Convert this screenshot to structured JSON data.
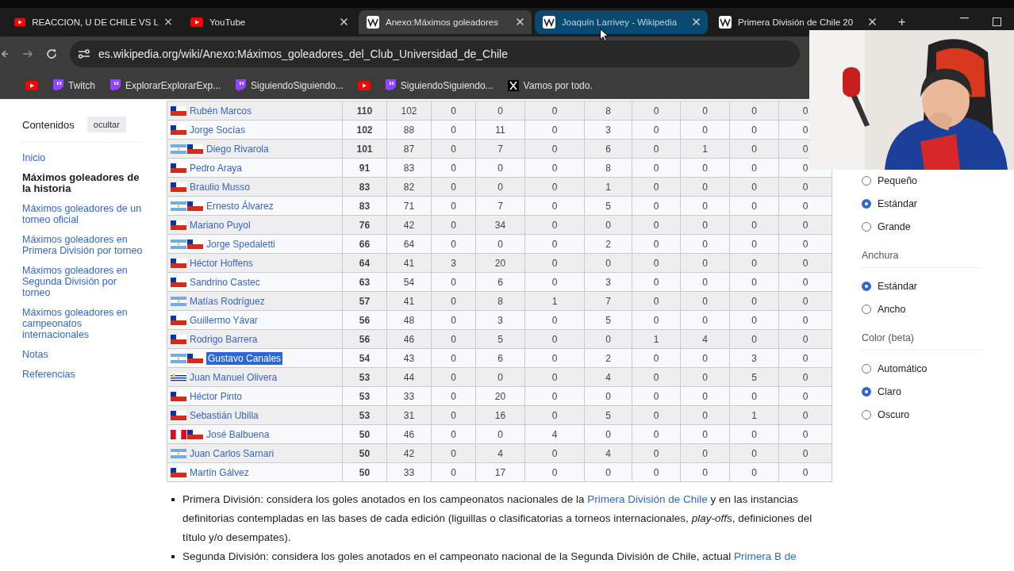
{
  "tabs": [
    {
      "title": "REACCION, U DE CHILE VS L",
      "kind": "youtube",
      "active": false,
      "hovered": false
    },
    {
      "title": "YouTube",
      "kind": "youtube",
      "active": false,
      "hovered": false
    },
    {
      "title": "Anexo:Máximos goleadores",
      "kind": "wikipedia",
      "active": true,
      "hovered": false
    },
    {
      "title": "Joaquín Larrivey - Wikipedia",
      "kind": "wikipedia",
      "active": false,
      "hovered": true
    },
    {
      "title": "Primera División de Chile 20",
      "kind": "wikipedia",
      "active": false,
      "hovered": false
    }
  ],
  "new_tab": "+",
  "address_bar": {
    "url": "es.wikipedia.org/wiki/Anexo:Máximos_goleadores_del_Club_Universidad_de_Chile"
  },
  "bookmarks": [
    {
      "kind": "youtube"
    },
    {
      "kind": "twitch",
      "label": "Twitch"
    },
    {
      "kind": "twitch",
      "label": "ExplorarExplorarExp..."
    },
    {
      "kind": "twitch",
      "label": "SiguiendoSiguiendo..."
    },
    {
      "kind": "youtube"
    },
    {
      "kind": "twitch",
      "label": "SiguiendoSiguiendo..."
    },
    {
      "kind": "x",
      "label": "Vamos por todo."
    }
  ],
  "contents": {
    "title": "Contenidos",
    "hide_button": "ocultar",
    "items": [
      {
        "label": "Inicio",
        "selected": false
      },
      {
        "label": "Máximos goleadores de la historia",
        "selected": true
      },
      {
        "label": "Máximos goleadores de un torneo oficial",
        "selected": false
      },
      {
        "label": "Máximos goleadores en Primera División por torneo",
        "selected": false
      },
      {
        "label": "Máximos goleadores en Segunda División por torneo",
        "selected": false
      },
      {
        "label": "Máximos goleadores en campeonatos internacionales",
        "selected": false
      },
      {
        "label": "Notas",
        "selected": false
      },
      {
        "label": "Referencias",
        "selected": false
      }
    ]
  },
  "table": {
    "rows": [
      {
        "name": "Rubén Marcos",
        "flags": [
          {
            "kind": "chile"
          }
        ],
        "text_selected": false,
        "values": [
          "110",
          "102",
          "0",
          "0",
          "0",
          "8",
          "0",
          "0",
          "0",
          "0"
        ]
      },
      {
        "name": "Jorge Socías",
        "flags": [
          {
            "kind": "chile"
          }
        ],
        "text_selected": false,
        "values": [
          "102",
          "88",
          "0",
          "11",
          "0",
          "3",
          "0",
          "0",
          "0",
          "0"
        ]
      },
      {
        "name": "Diego Rivarola",
        "flags": [
          {
            "kind": "argentina"
          },
          {
            "kind": "chile"
          }
        ],
        "text_selected": false,
        "values": [
          "101",
          "87",
          "0",
          "7",
          "0",
          "6",
          "0",
          "1",
          "0",
          "0"
        ]
      },
      {
        "name": "Pedro Araya",
        "flags": [
          {
            "kind": "chile"
          }
        ],
        "text_selected": false,
        "values": [
          "91",
          "83",
          "0",
          "0",
          "0",
          "8",
          "0",
          "0",
          "0",
          "0"
        ]
      },
      {
        "name": "Braulio Musso",
        "flags": [
          {
            "kind": "chile"
          }
        ],
        "text_selected": false,
        "values": [
          "83",
          "82",
          "0",
          "0",
          "0",
          "1",
          "0",
          "0",
          "0",
          "0"
        ]
      },
      {
        "name": "Ernesto Álvarez",
        "flags": [
          {
            "kind": "argentina"
          },
          {
            "kind": "chile"
          }
        ],
        "text_selected": false,
        "values": [
          "83",
          "71",
          "0",
          "7",
          "0",
          "5",
          "0",
          "0",
          "0",
          "0"
        ]
      },
      {
        "name": "Mariano Puyol",
        "flags": [
          {
            "kind": "chile"
          }
        ],
        "text_selected": false,
        "values": [
          "76",
          "42",
          "0",
          "34",
          "0",
          "0",
          "0",
          "0",
          "0",
          "0"
        ]
      },
      {
        "name": "Jorge Spedaletti",
        "flags": [
          {
            "kind": "argentina"
          },
          {
            "kind": "chile"
          }
        ],
        "text_selected": false,
        "values": [
          "66",
          "64",
          "0",
          "0",
          "0",
          "2",
          "0",
          "0",
          "0",
          "0"
        ]
      },
      {
        "name": "Héctor Hoffens",
        "flags": [
          {
            "kind": "chile"
          }
        ],
        "text_selected": false,
        "values": [
          "64",
          "41",
          "3",
          "20",
          "0",
          "0",
          "0",
          "0",
          "0",
          "0"
        ]
      },
      {
        "name": "Sandrino Castec",
        "flags": [
          {
            "kind": "chile"
          }
        ],
        "text_selected": false,
        "values": [
          "63",
          "54",
          "0",
          "6",
          "0",
          "3",
          "0",
          "0",
          "0",
          "0"
        ]
      },
      {
        "name": "Matías Rodríguez",
        "flags": [
          {
            "kind": "argentina"
          }
        ],
        "text_selected": false,
        "values": [
          "57",
          "41",
          "0",
          "8",
          "1",
          "7",
          "0",
          "0",
          "0",
          "0"
        ]
      },
      {
        "name": "Guillermo Yávar",
        "flags": [
          {
            "kind": "chile"
          }
        ],
        "text_selected": false,
        "values": [
          "56",
          "48",
          "0",
          "3",
          "0",
          "5",
          "0",
          "0",
          "0",
          "0"
        ]
      },
      {
        "name": "Rodrigo Barrera",
        "flags": [
          {
            "kind": "chile"
          }
        ],
        "text_selected": false,
        "values": [
          "56",
          "46",
          "0",
          "5",
          "0",
          "0",
          "1",
          "4",
          "0",
          "0"
        ]
      },
      {
        "name": "Gustavo Canales",
        "flags": [
          {
            "kind": "argentina"
          },
          {
            "kind": "chile"
          }
        ],
        "text_selected": true,
        "values": [
          "54",
          "43",
          "0",
          "6",
          "0",
          "2",
          "0",
          "0",
          "3",
          "0"
        ]
      },
      {
        "name": "Juan Manuel Olivera",
        "flags": [
          {
            "kind": "uruguay"
          }
        ],
        "text_selected": false,
        "values": [
          "53",
          "44",
          "0",
          "0",
          "0",
          "4",
          "0",
          "0",
          "5",
          "0"
        ]
      },
      {
        "name": "Héctor Pinto",
        "flags": [
          {
            "kind": "chile"
          }
        ],
        "text_selected": false,
        "values": [
          "53",
          "33",
          "0",
          "20",
          "0",
          "0",
          "0",
          "0",
          "0",
          "0"
        ]
      },
      {
        "name": "Sebastián Ubilla",
        "flags": [
          {
            "kind": "chile"
          }
        ],
        "text_selected": false,
        "values": [
          "53",
          "31",
          "0",
          "16",
          "0",
          "5",
          "0",
          "0",
          "1",
          "0"
        ]
      },
      {
        "name": "José Balbuena",
        "flags": [
          {
            "kind": "peru"
          },
          {
            "kind": "chile"
          }
        ],
        "text_selected": false,
        "values": [
          "50",
          "46",
          "0",
          "0",
          "4",
          "0",
          "0",
          "0",
          "0",
          "0"
        ]
      },
      {
        "name": "Juan Carlos Sarnari",
        "flags": [
          {
            "kind": "argentina"
          }
        ],
        "text_selected": false,
        "values": [
          "50",
          "42",
          "0",
          "4",
          "0",
          "4",
          "0",
          "0",
          "0",
          "0"
        ]
      },
      {
        "name": "Martín Gálvez",
        "flags": [
          {
            "kind": "chile"
          }
        ],
        "text_selected": false,
        "values": [
          "50",
          "33",
          "0",
          "17",
          "0",
          "0",
          "0",
          "0",
          "0",
          "0"
        ]
      }
    ]
  },
  "notes": [
    [
      {
        "kind": "text",
        "text": "Primera División: considera los goles anotados en los campeonatos nacionales de la "
      },
      {
        "kind": "link",
        "text": "Primera División de Chile"
      },
      {
        "kind": "text",
        "text": " y en las instancias definitorias contempladas en las bases de cada edición (liguillas o clasificatorias a torneos internacionales, *play-offs*, definiciones del título y/o desempates)."
      }
    ],
    [
      {
        "kind": "text",
        "text": "Segunda División: considera los goles anotados en el campeonato nacional de la Segunda División de Chile, actual "
      },
      {
        "kind": "link",
        "text": "Primera B de"
      }
    ]
  ],
  "appearance": [
    {
      "options": [
        {
          "label": "Pequeño",
          "selected": false
        },
        {
          "label": "Estándar",
          "selected": true
        },
        {
          "label": "Grande",
          "selected": false
        }
      ]
    },
    {
      "title": "Anchura",
      "options": [
        {
          "label": "Estándar",
          "selected": true
        },
        {
          "label": "Ancho",
          "selected": false
        }
      ]
    },
    {
      "title": "Color (beta)",
      "options": [
        {
          "label": "Automático",
          "selected": false
        },
        {
          "label": "Claro",
          "selected": true
        },
        {
          "label": "Oscuro",
          "selected": false
        }
      ]
    }
  ],
  "webcam": {
    "kind": "picture"
  }
}
